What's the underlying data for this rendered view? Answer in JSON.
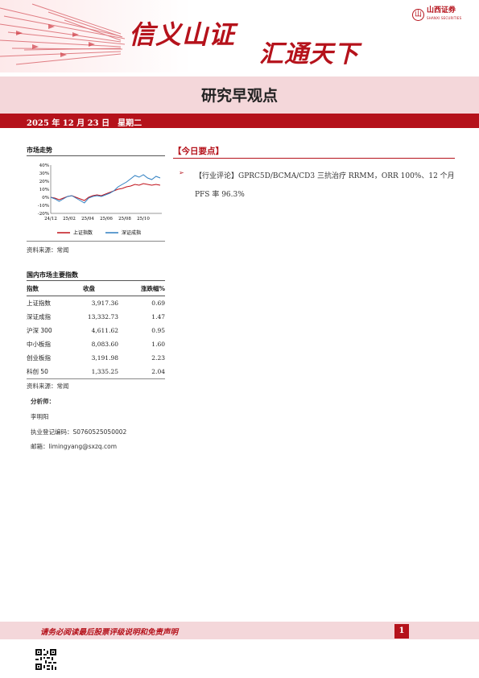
{
  "header": {
    "slogan_left": "信义山证",
    "slogan_right": "汇通天下",
    "logo_text": "山西证券",
    "logo_sub": "SHANXI SECURITIES",
    "report_title": "研究早观点",
    "date": "2025 年 12 月 23 日　星期二",
    "brand_color": "#b5121b"
  },
  "market_trend": {
    "heading": "市场走势",
    "source": "资料来源：常闻"
  },
  "chart_data": {
    "type": "line",
    "x_ticks": [
      "24/12",
      "25/02",
      "25/04",
      "25/06",
      "25/08",
      "25/10"
    ],
    "y_ticks": [
      "40%",
      "30%",
      "20%",
      "10%",
      "0%",
      "-10%",
      "-20%"
    ],
    "ylim": [
      -20,
      40
    ],
    "series": [
      {
        "name": "上证指数",
        "color": "#c0121b",
        "values": [
          0,
          -1,
          -3,
          -1,
          1,
          2,
          0,
          -2,
          -4,
          0,
          2,
          3,
          2,
          4,
          6,
          8,
          10,
          11,
          13,
          14,
          16,
          15,
          17,
          16,
          15,
          16,
          15
        ]
      },
      {
        "name": "深证成指",
        "color": "#2f7fc1",
        "values": [
          0,
          -2,
          -5,
          -2,
          1,
          2,
          -1,
          -4,
          -7,
          -1,
          1,
          2,
          1,
          3,
          5,
          8,
          13,
          16,
          19,
          23,
          27,
          25,
          28,
          24,
          22,
          26,
          24
        ]
      }
    ]
  },
  "indices": {
    "heading": "国内市场主要指数",
    "columns": [
      "指数",
      "收盘",
      "涨跌幅%"
    ],
    "rows": [
      {
        "name": "上证指数",
        "close": "3,917.36",
        "chg": "0.69"
      },
      {
        "name": "深证成指",
        "close": "13,332.73",
        "chg": "1.47"
      },
      {
        "name": "沪深 300",
        "close": "4,611.62",
        "chg": "0.95"
      },
      {
        "name": "中小板指",
        "close": "8,083.60",
        "chg": "1.60"
      },
      {
        "name": "创业板指",
        "close": "3,191.98",
        "chg": "2.23"
      },
      {
        "name": "科创 50",
        "close": "1,335.25",
        "chg": "2.04"
      }
    ],
    "source": "资料来源：常闻"
  },
  "analyst": {
    "label": "分析师：",
    "name": "李明阳",
    "license": "执业登记编码：S0760525050002",
    "email": "邮箱：limingyang@sxzq.com"
  },
  "today": {
    "heading": "【今日要点】",
    "item": "【行业评论】GPRC5D/BCMA/CD3 三抗治疗 RRMM，ORR 100%、12 个月 PFS 率 96.3%"
  },
  "footer": {
    "notice": "请务必阅读最后股票评级说明和免责声明",
    "page": "1"
  }
}
